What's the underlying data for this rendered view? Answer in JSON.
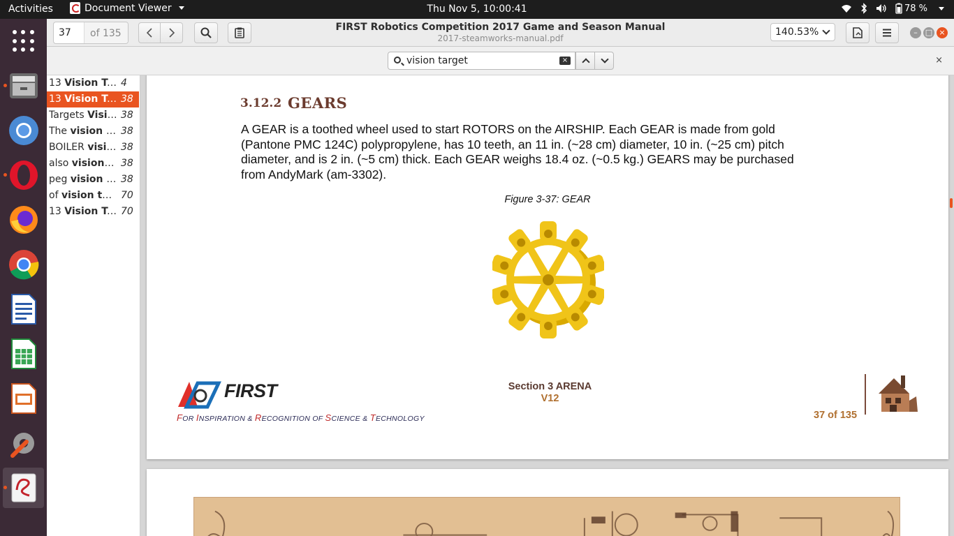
{
  "topbar": {
    "activities": "Activities",
    "app_name": "Document Viewer",
    "clock": "Thu Nov  5, 10:00:41",
    "battery": "78 %"
  },
  "dock": {
    "items": [
      "show-applications",
      "files",
      "chromium",
      "opera",
      "firefox",
      "chrome",
      "libreoffice-writer",
      "libreoffice-calc",
      "libreoffice-impress",
      "system-tools",
      "document-viewer"
    ]
  },
  "header": {
    "page_number": "37",
    "page_total": "of 135",
    "title": "FIRST Robotics Competition 2017 Game and Season Manual",
    "subtitle": "2017-steamworks-manual.pdf",
    "zoom": "140.53%"
  },
  "find": {
    "query": "vision target",
    "close": "×"
  },
  "results": [
    {
      "pre": "13 ",
      "hit": "Vision Ta...",
      "page": "4"
    },
    {
      "pre": "13 ",
      "hit": "Vision Ta...",
      "page": "38"
    },
    {
      "pre": "Targets ",
      "hit": "Visi...",
      "page": "38"
    },
    {
      "pre": "The ",
      "hit": "vision t...",
      "page": "38"
    },
    {
      "pre": "BOILER ",
      "hit": "visi...",
      "page": "38"
    },
    {
      "pre": "also ",
      "hit": "vision t...",
      "page": "38"
    },
    {
      "pre": "peg ",
      "hit": "vision t...",
      "page": "38"
    },
    {
      "pre": "of ",
      "hit": "vision ta...",
      "page": "70"
    },
    {
      "pre": "13 ",
      "hit": "Vision Ta...",
      "page": "70"
    }
  ],
  "document": {
    "section_number": "3.12.2",
    "section_title": "GEARS",
    "body_lines": [
      "A GEAR is a toothed wheel used to start ROTORS on the AIRSHIP. Each GEAR is made from gold",
      "(Pantone PMC 124C) polypropylene, has 10 teeth, an 11 in. (~28 cm) diameter, 10 in. (~25 cm) pitch",
      "diameter, and is 2 in. (~5 cm) thick. Each GEAR weighs 18.4 oz. (~0.5 kg.) GEARS may be purchased",
      "from AndyMark (am-3302)."
    ],
    "figure_caption": "Figure 3-37: GEAR",
    "footer": {
      "logo_text": "FIRST",
      "tagline": [
        {
          "cap": "F",
          "rest": "OR "
        },
        {
          "cap": "I",
          "rest": "NSPIRATION & "
        },
        {
          "cap": "R",
          "rest": "ECOGNITION OF "
        },
        {
          "cap": "S",
          "rest": "CIENCE & "
        },
        {
          "cap": "T",
          "rest": "ECHNOLOGY"
        }
      ],
      "section": "Section 3 ARENA",
      "version": "V12",
      "page": "37 of 135"
    }
  },
  "colors": {
    "accent": "#e95420",
    "heading": "#6b3b2e",
    "gear": "#f0c419",
    "footer_orange": "#b07030"
  }
}
